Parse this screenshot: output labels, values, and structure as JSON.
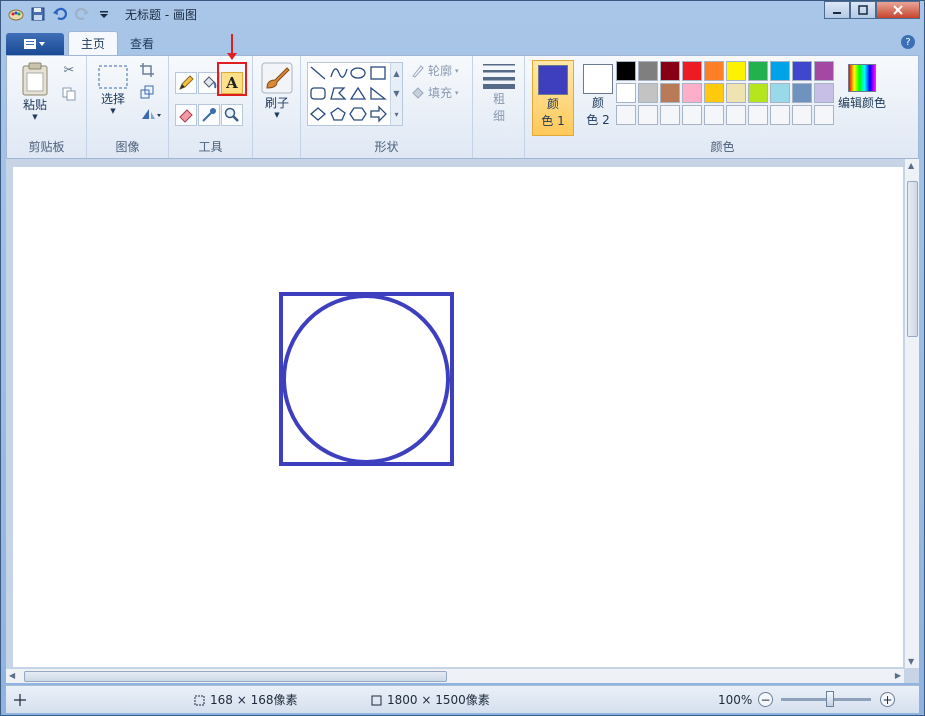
{
  "window": {
    "title": "无标题 - 画图"
  },
  "tabs": {
    "home": "主页",
    "view": "查看"
  },
  "groups": {
    "clipboard": "剪贴板",
    "image": "图像",
    "tools": "工具",
    "shapes": "形状",
    "colors": "颜色"
  },
  "buttons": {
    "paste": "粘贴",
    "select": "选择",
    "brushes": "刷子",
    "outline": "轮廓",
    "fill": "填充",
    "size_top": "粗",
    "size_bottom": "细",
    "color1_top": "颜",
    "color1_bottom": "色 1",
    "color2_top": "颜",
    "color2_bottom": "色 2",
    "edit_colors": "编辑颜色"
  },
  "colors": {
    "color1": "#3d3fbf",
    "color2": "#ffffff",
    "palette_row1": [
      "#000000",
      "#7f7f7f",
      "#880015",
      "#ed1c24",
      "#ff7f27",
      "#fff200",
      "#22b14c",
      "#00a2e8",
      "#3f48cc",
      "#a349a4"
    ],
    "palette_row2": [
      "#ffffff",
      "#c3c3c3",
      "#b97a57",
      "#ffaec9",
      "#ffc90e",
      "#efe4b0",
      "#b5e61d",
      "#99d9ea",
      "#7092be",
      "#c8bfe7"
    ],
    "palette_row3": [
      "#f4f6f9",
      "#f4f6f9",
      "#f4f6f9",
      "#f4f6f9",
      "#f4f6f9",
      "#f4f6f9",
      "#f4f6f9",
      "#f4f6f9",
      "#f4f6f9",
      "#f4f6f9"
    ]
  },
  "tools": {
    "text_tool_glyph": "A"
  },
  "status": {
    "selection_size": "168 × 168像素",
    "canvas_size": "1800 × 1500像素",
    "zoom": "100%"
  }
}
